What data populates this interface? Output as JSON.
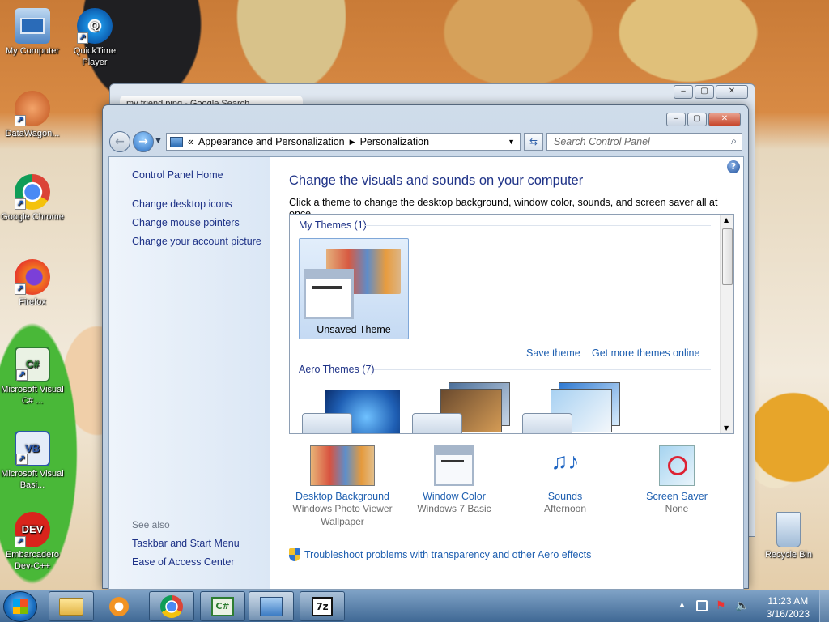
{
  "desktop": {
    "icons": [
      {
        "label": "My Computer"
      },
      {
        "label": "QuickTime Player"
      },
      {
        "label": "DataWagon..."
      },
      {
        "label": "Google Chrome"
      },
      {
        "label": "Firefox"
      },
      {
        "label": "Microsoft Visual C# ..."
      },
      {
        "label": "Microsoft Visual Basi..."
      },
      {
        "label": "Embarcadero Dev-C++"
      },
      {
        "label": "Recycle Bin"
      }
    ]
  },
  "background_window": {
    "tab_title": "my friend ping - Google Search"
  },
  "window": {
    "breadcrumb": {
      "lead": "«",
      "items": [
        "Appearance and Personalization",
        "Personalization"
      ]
    },
    "search_placeholder": "Search Control Panel",
    "sidebar": {
      "home": "Control Panel Home",
      "links": [
        "Change desktop icons",
        "Change mouse pointers",
        "Change your account picture"
      ],
      "see_also_label": "See also",
      "see_also": [
        "Taskbar and Start Menu",
        "Ease of Access Center"
      ]
    },
    "title": "Change the visuals and sounds on your computer",
    "subtitle": "Click a theme to change the desktop background, window color, sounds, and screen saver all at once.",
    "themes": {
      "my_themes": "My Themes (1)",
      "selected_theme": "Unsaved Theme",
      "save_theme": "Save theme",
      "get_more": "Get more themes online",
      "aero_themes": "Aero Themes (7)"
    },
    "options": [
      {
        "title": "Desktop Background",
        "sub": "Windows Photo Viewer Wallpaper"
      },
      {
        "title": "Window Color",
        "sub": "Windows 7 Basic"
      },
      {
        "title": "Sounds",
        "sub": "Afternoon"
      },
      {
        "title": "Screen Saver",
        "sub": "None"
      }
    ],
    "troubleshoot": "Troubleshoot problems with transparency and other Aero effects"
  },
  "taskbar": {
    "time": "11:23 AM",
    "date": "3/16/2023"
  },
  "colors": {
    "link": "#1e5fb0",
    "heading": "#1e3287"
  }
}
